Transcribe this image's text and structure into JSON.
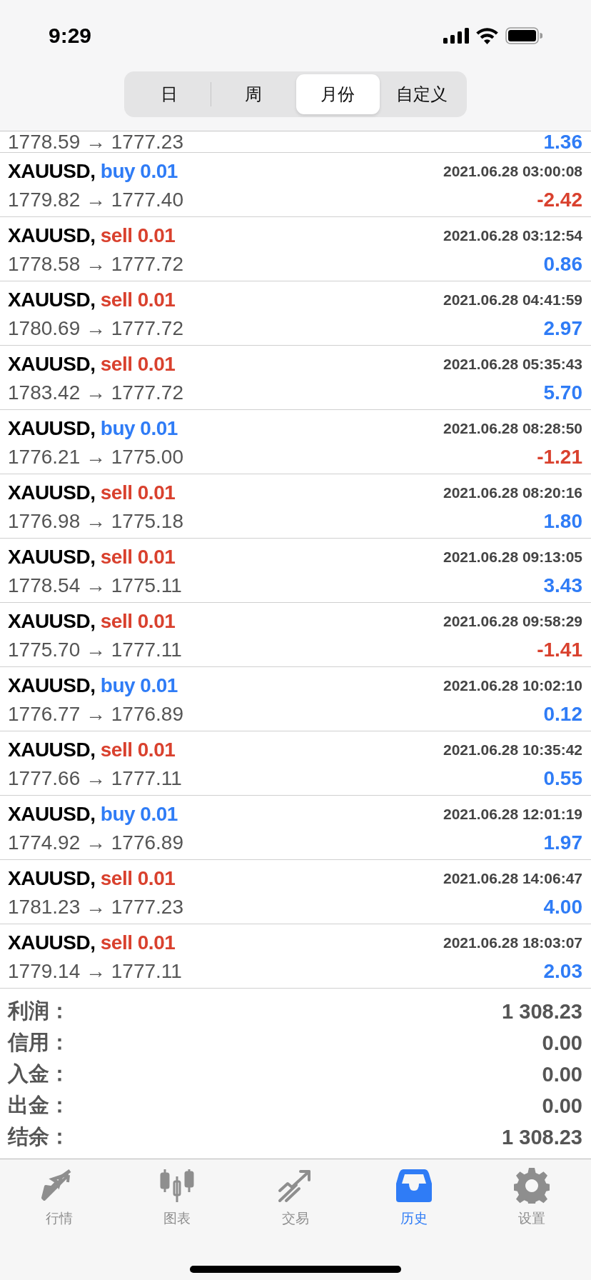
{
  "status_bar": {
    "time": "9:29"
  },
  "segments": [
    {
      "label": "日",
      "selected": false
    },
    {
      "label": "周",
      "selected": false
    },
    {
      "label": "月份",
      "selected": true
    },
    {
      "label": "自定义",
      "selected": false
    }
  ],
  "partial_row": {
    "prices": "1778.59 → 1777.23",
    "profit": {
      "text": "1.36",
      "color": "#2f7cf6"
    }
  },
  "trades": [
    {
      "symbol": "XAUUSD,",
      "order": {
        "text": "buy 0.01",
        "color": "#2f7cf6"
      },
      "time": "2021.06.28 03:00:08",
      "prices": "1779.82 → 1777.40",
      "profit": {
        "text": "-2.42",
        "color": "#d9412e"
      }
    },
    {
      "symbol": "XAUUSD,",
      "order": {
        "text": "sell 0.01",
        "color": "#d9412e"
      },
      "time": "2021.06.28 03:12:54",
      "prices": "1778.58 → 1777.72",
      "profit": {
        "text": "0.86",
        "color": "#2f7cf6"
      }
    },
    {
      "symbol": "XAUUSD,",
      "order": {
        "text": "sell 0.01",
        "color": "#d9412e"
      },
      "time": "2021.06.28 04:41:59",
      "prices": "1780.69 → 1777.72",
      "profit": {
        "text": "2.97",
        "color": "#2f7cf6"
      }
    },
    {
      "symbol": "XAUUSD,",
      "order": {
        "text": "sell 0.01",
        "color": "#d9412e"
      },
      "time": "2021.06.28 05:35:43",
      "prices": "1783.42 → 1777.72",
      "profit": {
        "text": "5.70",
        "color": "#2f7cf6"
      }
    },
    {
      "symbol": "XAUUSD,",
      "order": {
        "text": "buy 0.01",
        "color": "#2f7cf6"
      },
      "time": "2021.06.28 08:28:50",
      "prices": "1776.21 → 1775.00",
      "profit": {
        "text": "-1.21",
        "color": "#d9412e"
      }
    },
    {
      "symbol": "XAUUSD,",
      "order": {
        "text": "sell 0.01",
        "color": "#d9412e"
      },
      "time": "2021.06.28 08:20:16",
      "prices": "1776.98 → 1775.18",
      "profit": {
        "text": "1.80",
        "color": "#2f7cf6"
      }
    },
    {
      "symbol": "XAUUSD,",
      "order": {
        "text": "sell 0.01",
        "color": "#d9412e"
      },
      "time": "2021.06.28 09:13:05",
      "prices": "1778.54 → 1775.11",
      "profit": {
        "text": "3.43",
        "color": "#2f7cf6"
      }
    },
    {
      "symbol": "XAUUSD,",
      "order": {
        "text": "sell 0.01",
        "color": "#d9412e"
      },
      "time": "2021.06.28 09:58:29",
      "prices": "1775.70 → 1777.11",
      "profit": {
        "text": "-1.41",
        "color": "#d9412e"
      }
    },
    {
      "symbol": "XAUUSD,",
      "order": {
        "text": "buy 0.01",
        "color": "#2f7cf6"
      },
      "time": "2021.06.28 10:02:10",
      "prices": "1776.77 → 1776.89",
      "profit": {
        "text": "0.12",
        "color": "#2f7cf6"
      }
    },
    {
      "symbol": "XAUUSD,",
      "order": {
        "text": "sell 0.01",
        "color": "#d9412e"
      },
      "time": "2021.06.28 10:35:42",
      "prices": "1777.66 → 1777.11",
      "profit": {
        "text": "0.55",
        "color": "#2f7cf6"
      }
    },
    {
      "symbol": "XAUUSD,",
      "order": {
        "text": "buy 0.01",
        "color": "#2f7cf6"
      },
      "time": "2021.06.28 12:01:19",
      "prices": "1774.92 → 1776.89",
      "profit": {
        "text": "1.97",
        "color": "#2f7cf6"
      }
    },
    {
      "symbol": "XAUUSD,",
      "order": {
        "text": "sell 0.01",
        "color": "#d9412e"
      },
      "time": "2021.06.28 14:06:47",
      "prices": "1781.23 → 1777.23",
      "profit": {
        "text": "4.00",
        "color": "#2f7cf6"
      }
    },
    {
      "symbol": "XAUUSD,",
      "order": {
        "text": "sell 0.01",
        "color": "#d9412e"
      },
      "time": "2021.06.28 18:03:07",
      "prices": "1779.14 → 1777.11",
      "profit": {
        "text": "2.03",
        "color": "#2f7cf6"
      }
    }
  ],
  "summary": [
    {
      "label": "利润：",
      "value": "1 308.23"
    },
    {
      "label": "信用：",
      "value": "0.00"
    },
    {
      "label": "入金：",
      "value": "0.00"
    },
    {
      "label": "出金：",
      "value": "0.00"
    },
    {
      "label": "结余：",
      "value": "1 308.23"
    }
  ],
  "tabs": [
    {
      "label": "行情",
      "kind": "arrows",
      "selected": false
    },
    {
      "label": "图表",
      "kind": "candles",
      "selected": false
    },
    {
      "label": "交易",
      "kind": "trend",
      "selected": false
    },
    {
      "label": "历史",
      "kind": "tray",
      "selected": true
    },
    {
      "label": "设置",
      "kind": "gear",
      "selected": false
    }
  ]
}
